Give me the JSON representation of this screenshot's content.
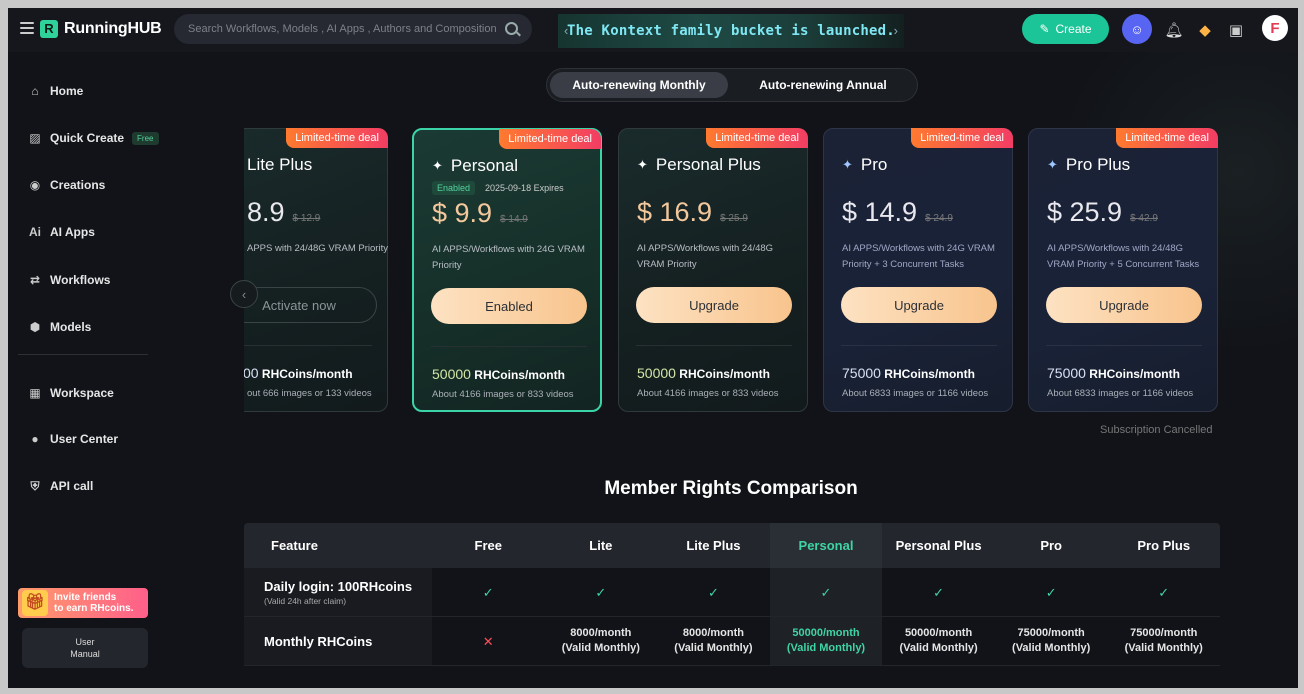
{
  "header": {
    "logo_text": "RunningHUB",
    "search_placeholder": "Search Workflows, Models , AI Apps , Authors and Composition",
    "banner_text": "The Kontext family bucket is launched.",
    "create_label": "Create",
    "avatar_letter": "F"
  },
  "sidebar": {
    "items": [
      {
        "label": "Home",
        "icon": "home-icon"
      },
      {
        "label": "Quick Create",
        "icon": "quick-create-icon",
        "badge": "Free"
      },
      {
        "label": "Creations",
        "icon": "creations-icon"
      },
      {
        "label": "AI Apps",
        "icon": "ai-apps-icon"
      },
      {
        "label": "Workflows",
        "icon": "workflows-icon"
      },
      {
        "label": "Models",
        "icon": "models-icon"
      },
      {
        "label": "Workspace",
        "icon": "workspace-icon"
      },
      {
        "label": "User Center",
        "icon": "user-center-icon"
      },
      {
        "label": "API call",
        "icon": "api-icon"
      }
    ],
    "invite_line1": "Invite friends",
    "invite_line2": "to earn RHcoins.",
    "manual_line1": "User",
    "manual_line2": "Manual"
  },
  "billing_toggle": {
    "monthly": "Auto-renewing Monthly",
    "annual": "Auto-renewing Annual"
  },
  "plans": [
    {
      "name": "Lite Plus",
      "deal": "Limited-time deal",
      "price": "8.9",
      "old_price": "$ 12.9",
      "desc": "APPS with 24/48G VRAM Priority",
      "button": "Activate now",
      "coins": "00",
      "coins_unit": "RHCoins/month",
      "coins_sub": "out 666 images or 133 videos"
    },
    {
      "name": "Personal",
      "deal": "Limited-time deal",
      "enabled_badge": "Enabled",
      "expires": "2025-09-18 Expires",
      "price": "$ 9.9",
      "old_price": "$ 14.9",
      "desc": "AI APPS/Workflows with 24G VRAM Priority",
      "button": "Enabled",
      "coins": "50000",
      "coins_unit": "RHCoins/month",
      "coins_sub": "About 4166 images or 833 videos"
    },
    {
      "name": "Personal Plus",
      "deal": "Limited-time deal",
      "price": "$ 16.9",
      "old_price": "$ 25.9",
      "desc": "AI APPS/Workflows with 24/48G VRAM Priority",
      "button": "Upgrade",
      "coins": "50000",
      "coins_unit": "RHCoins/month",
      "coins_sub": "About 4166 images or 833 videos"
    },
    {
      "name": "Pro",
      "deal": "Limited-time deal",
      "price": "$ 14.9",
      "old_price": "$ 24.9",
      "desc": "AI APPS/Workflows with 24G VRAM Priority + 3 Concurrent Tasks",
      "button": "Upgrade",
      "coins": "75000",
      "coins_unit": "RHCoins/month",
      "coins_sub": "About 6833 images or 1166 videos"
    },
    {
      "name": "Pro Plus",
      "deal": "Limited-time deal",
      "price": "$ 25.9",
      "old_price": "$ 42.9",
      "desc": "AI APPS/Workflows with 24/48G VRAM Priority + 5 Concurrent Tasks",
      "button": "Upgrade",
      "coins": "75000",
      "coins_unit": "RHCoins/month",
      "coins_sub": "About 6833 images or 1166 videos"
    }
  ],
  "subscription_status": "Subscription Cancelled",
  "comparison": {
    "title": "Member Rights Comparison",
    "headers": [
      "Feature",
      "Free",
      "Lite",
      "Lite Plus",
      "Personal",
      "Personal Plus",
      "Pro",
      "Pro Plus"
    ],
    "rows": [
      {
        "feature": "Daily login: 100RHcoins",
        "feature_sub": "(Valid 24h after claim)",
        "cells": [
          "check",
          "check",
          "check",
          "check",
          "check",
          "check",
          "check"
        ]
      },
      {
        "feature": "Monthly RHCoins",
        "feature_sub": "",
        "cells": [
          "cross",
          "8000/month|(Valid Monthly)",
          "8000/month|(Valid Monthly)",
          "50000/month|(Valid Monthly)",
          "50000/month|(Valid Monthly)",
          "75000/month|(Valid Monthly)",
          "75000/month|(Valid Monthly)"
        ]
      }
    ]
  },
  "colors": {
    "accent": "#1cc597",
    "deal_start": "#ff7a2f",
    "deal_end": "#f23d64",
    "button_gold": "#f8c48d"
  }
}
